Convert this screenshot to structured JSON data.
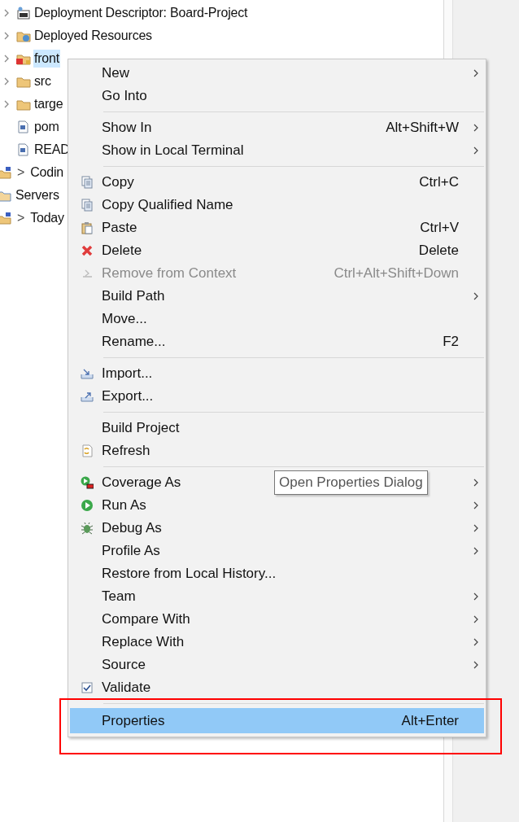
{
  "tree": {
    "nested_items": [
      {
        "label": "Deployment Descriptor: Board-Project",
        "kind": "descriptor",
        "expandable": true,
        "selected": false
      },
      {
        "label": "Deployed Resources",
        "kind": "resources",
        "expandable": true,
        "selected": false
      },
      {
        "label": "front",
        "kind": "project",
        "expandable": true,
        "selected": true
      },
      {
        "label": "src",
        "kind": "folder",
        "expandable": true,
        "selected": false
      },
      {
        "label": "targe",
        "kind": "folder",
        "expandable": true,
        "selected": false
      },
      {
        "label": "pom",
        "kind": "file",
        "expandable": false,
        "selected": false
      },
      {
        "label": "READ",
        "kind": "file",
        "expandable": false,
        "selected": false
      }
    ],
    "items": [
      {
        "prefix": ">",
        "label": "Codin",
        "kind": "project",
        "selected": false
      },
      {
        "label": "Servers",
        "kind": "folder",
        "selected": false
      },
      {
        "prefix": ">",
        "label": "Today",
        "kind": "project",
        "selected": false
      }
    ]
  },
  "context_menu": {
    "groups": [
      [
        {
          "label": "New",
          "submenu": true,
          "disabled": false,
          "selected": false
        },
        {
          "label": "Go Into",
          "submenu": false,
          "disabled": false,
          "selected": false
        }
      ],
      [
        {
          "label": "Show In",
          "shortcut": "Alt+Shift+W",
          "submenu": true,
          "disabled": false,
          "selected": false
        },
        {
          "label": "Show in Local Terminal",
          "submenu": true,
          "disabled": false,
          "selected": false
        }
      ],
      [
        {
          "label": "Copy",
          "kind": "copy",
          "shortcut": "Ctrl+C",
          "submenu": false,
          "disabled": false,
          "selected": false
        },
        {
          "label": "Copy Qualified Name",
          "kind": "copy",
          "submenu": false,
          "disabled": false,
          "selected": false
        },
        {
          "label": "Paste",
          "kind": "paste",
          "shortcut": "Ctrl+V",
          "submenu": false,
          "disabled": false,
          "selected": false
        },
        {
          "label": "Delete",
          "kind": "delete",
          "shortcut": "Delete",
          "submenu": false,
          "disabled": false,
          "selected": false
        },
        {
          "label": "Remove from Context",
          "kind": "remove",
          "shortcut": "Ctrl+Alt+Shift+Down",
          "submenu": false,
          "disabled": true,
          "selected": false
        },
        {
          "label": "Build Path",
          "submenu": true,
          "disabled": false,
          "selected": false
        },
        {
          "label": "Move...",
          "submenu": false,
          "disabled": false,
          "selected": false
        },
        {
          "label": "Rename...",
          "shortcut": "F2",
          "submenu": false,
          "disabled": false,
          "selected": false
        }
      ],
      [
        {
          "label": "Import...",
          "kind": "import",
          "submenu": false,
          "disabled": false,
          "selected": false
        },
        {
          "label": "Export...",
          "kind": "export",
          "submenu": false,
          "disabled": false,
          "selected": false
        }
      ],
      [
        {
          "label": "Build Project",
          "submenu": false,
          "disabled": false,
          "selected": false
        },
        {
          "label": "Refresh",
          "kind": "refresh",
          "submenu": false,
          "disabled": false,
          "selected": false
        }
      ],
      [
        {
          "label": "Coverage As",
          "kind": "coverage",
          "submenu": true,
          "disabled": false,
          "selected": false
        },
        {
          "label": "Run As",
          "kind": "run",
          "submenu": true,
          "disabled": false,
          "selected": false
        },
        {
          "label": "Debug As",
          "kind": "debug",
          "submenu": true,
          "disabled": false,
          "selected": false
        },
        {
          "label": "Profile As",
          "submenu": true,
          "disabled": false,
          "selected": false
        },
        {
          "label": "Restore from Local History...",
          "submenu": false,
          "disabled": false,
          "selected": false
        },
        {
          "label": "Team",
          "submenu": true,
          "disabled": false,
          "selected": false
        },
        {
          "label": "Compare With",
          "submenu": true,
          "disabled": false,
          "selected": false
        },
        {
          "label": "Replace With",
          "submenu": true,
          "disabled": false,
          "selected": false
        },
        {
          "label": "Source",
          "submenu": true,
          "disabled": false,
          "selected": false
        },
        {
          "label": "Validate",
          "kind": "checkbox",
          "checked": true,
          "submenu": false,
          "disabled": false,
          "selected": false
        }
      ],
      [
        {
          "label": "Properties",
          "shortcut": "Alt+Enter",
          "submenu": false,
          "disabled": false,
          "selected": true
        }
      ]
    ]
  },
  "tooltip": {
    "text": "Open Properties Dialog"
  }
}
